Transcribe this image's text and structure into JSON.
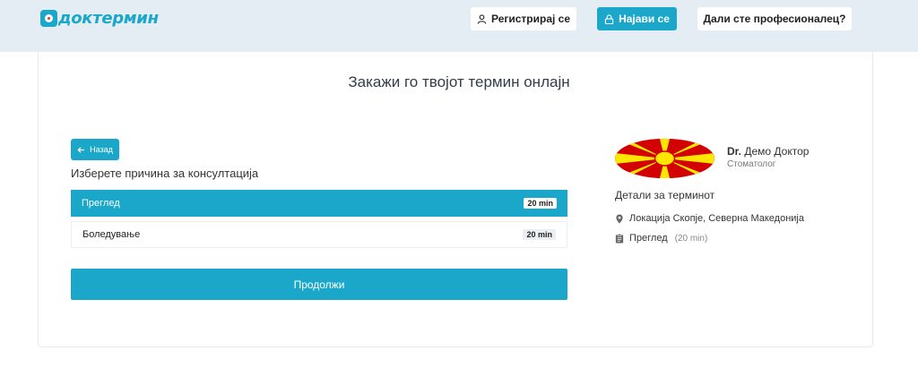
{
  "header": {
    "logo_text": "доктермин",
    "register_label": "Регистрирај се",
    "login_label": "Најави се",
    "pro_label": "Дали сте професионалец?"
  },
  "main": {
    "title": "Закажи го твојот термин онлајн",
    "back_label": "Назад",
    "section_label": "Изберете причина за консултација",
    "reasons": [
      {
        "label": "Преглед",
        "duration": "20 min",
        "selected": true
      },
      {
        "label": "Боледување",
        "duration": "20 min",
        "selected": false
      }
    ],
    "continue_label": "Продолжи"
  },
  "doctor": {
    "prefix": "Dr.",
    "name": "Демо Доктор",
    "specialty": "Стоматолог",
    "details_title": "Детали за терминот",
    "location": "Локација Скопје, Северна Македонија",
    "appointment_type": "Преглед",
    "appointment_duration": "(20 min)"
  },
  "colors": {
    "accent": "#1aa7c9",
    "header_bg": "#e4ecf4"
  }
}
